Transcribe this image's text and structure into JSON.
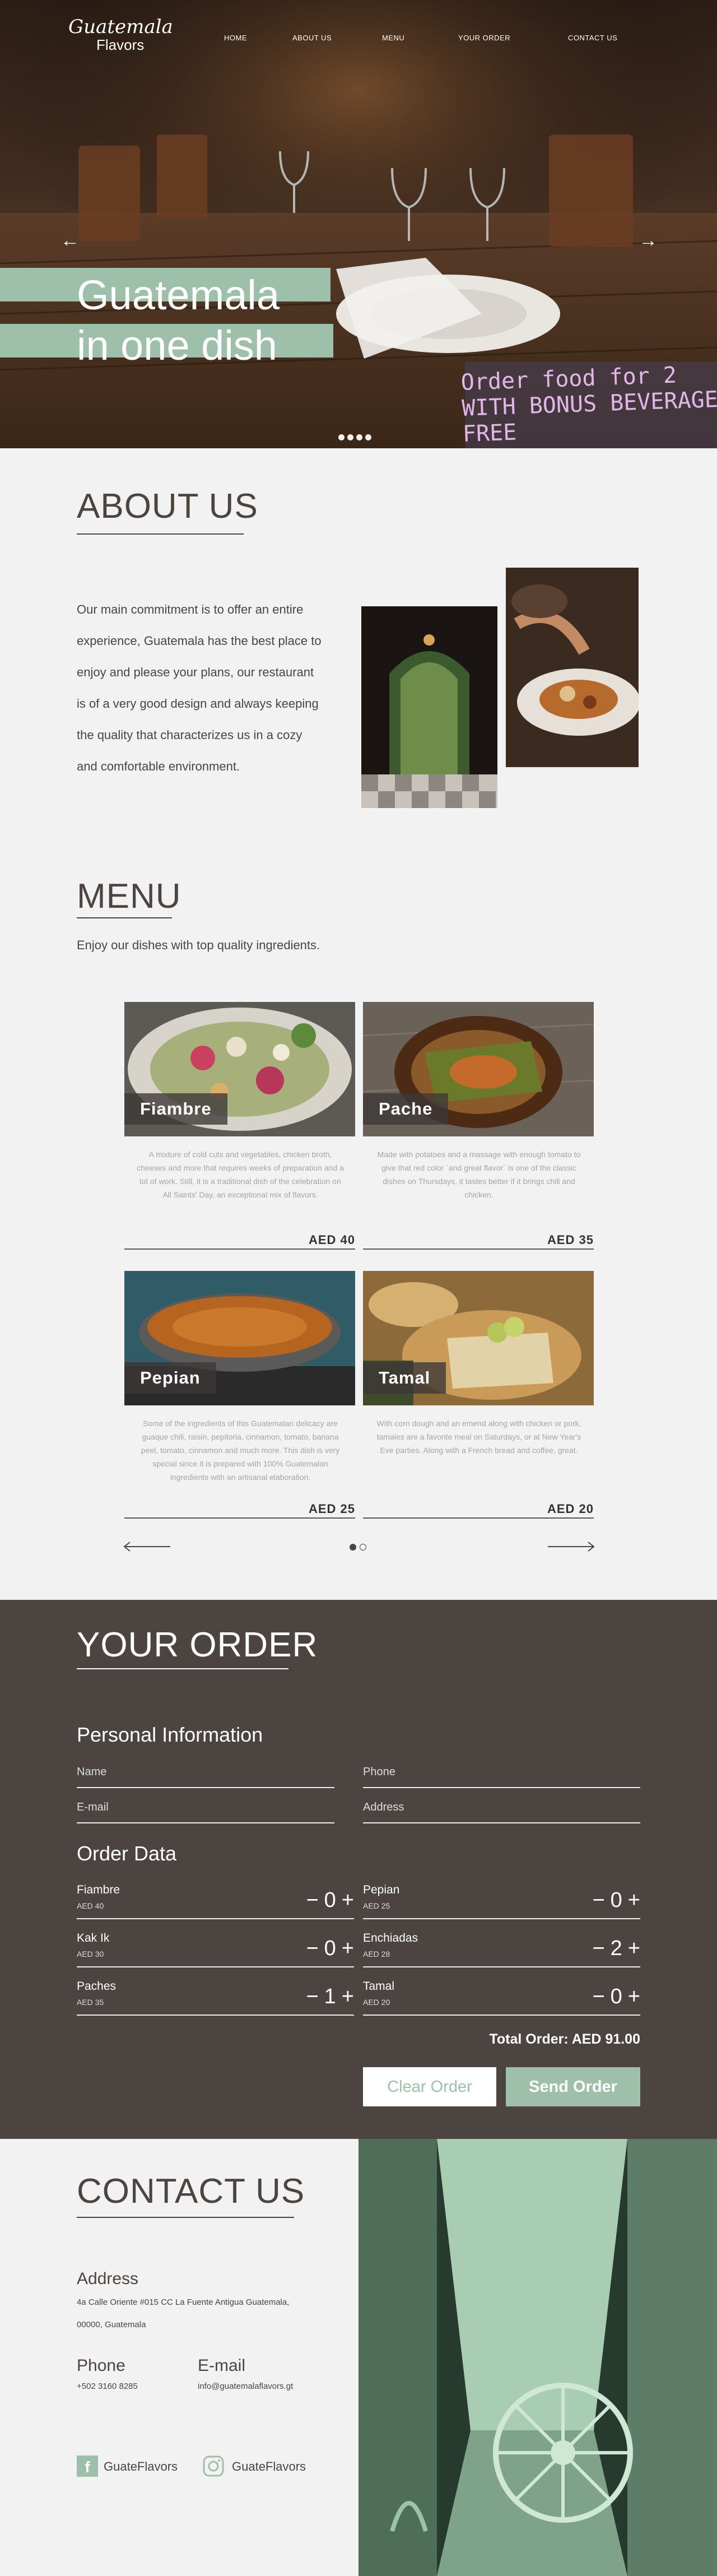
{
  "logo": {
    "line1": "Guatemala",
    "line2": "Flavors"
  },
  "nav": {
    "home": "HOME",
    "about": "ABOUT US",
    "menu": "MENU",
    "order": "YOUR ORDER",
    "contact": "CONTACT US"
  },
  "hero": {
    "title_line1": "Guatemala",
    "title_line2": "in one dish",
    "promo_line1": "Order food for 2",
    "promo_line2": "WITH BONUS BEVERAGE FREE",
    "slide_count": 4,
    "active_slide": 1
  },
  "about": {
    "title": "ABOUT US",
    "text": "Our main commitment is to offer an entire experience, Guatemala has the best place to enjoy and please your plans, our restaurant is of a very good design and always keeping the quality that characterizes us in a cozy and comfortable environment."
  },
  "menu": {
    "title": "MENU",
    "intro": "Enjoy our dishes with top quality ingredients.",
    "items": [
      {
        "name": "Fiambre",
        "desc": "A mixture of cold cuts and vegetables, chicken broth, cheeses and more that requires weeks of preparation and a lot of work. Still, it is a traditional dish of the celebration on All Saints' Day, an exceptional mix of flavors.",
        "price": "AED 40"
      },
      {
        "name": "Pache",
        "desc": "Made with potatoes and a massage with enough tomato to give that red color ´and great flavor´ is one of the classic dishes on Thursdays, it tastes better if it brings chili and chicken.",
        "price": "AED 35"
      },
      {
        "name": "Pepian",
        "desc": "Some of the ingredients of this Guatemalan delicacy are guaque chili, raisin, pepitoria, cinnamon, tomato, banana peel, tomato, cinnamon and much more. This dish is very special since it is prepared with 100% Guatemalan ingredients with an artisanal elaboration.",
        "price": "AED 25"
      },
      {
        "name": "Tamal",
        "desc": "With corn dough and an emend along with chicken or pork, tamales are a favorite meal on Saturdays, or at New Year's Eve parties. Along with a French bread and coffee, great.",
        "price": "AED 20"
      }
    ]
  },
  "order": {
    "title": "YOUR ORDER",
    "personal_title": "Personal Information",
    "name_ph": "Name",
    "phone_ph": "Phone",
    "email_ph": "E-mail",
    "address_ph": "Address",
    "data_title": "Order Data",
    "items": [
      {
        "name": "Fiambre",
        "price": "AED 40",
        "qty": "0"
      },
      {
        "name": "Pepian",
        "price": "AED 25",
        "qty": "0"
      },
      {
        "name": "Kak Ik",
        "price": "AED 30",
        "qty": "0"
      },
      {
        "name": "Enchiadas",
        "price": "AED 28",
        "qty": "2"
      },
      {
        "name": "Paches",
        "price": "AED 35",
        "qty": "1"
      },
      {
        "name": "Tamal",
        "price": "AED 20",
        "qty": "0"
      }
    ],
    "minus": "−",
    "plus": "+",
    "total": "Total Order: AED 91.00",
    "clear": "Clear Order",
    "send": "Send Order"
  },
  "contact": {
    "title": "CONTACT US",
    "address_label": "Address",
    "address_line1": "4a Calle Oriente #015 CC La Fuente Antigua Guatemala,",
    "address_line2": "00000, Guatemala",
    "phone_label": "Phone",
    "phone": "+502 3160 8285",
    "email_label": "E-mail",
    "email": "info@guatemalaflavors.gt",
    "facebook": "GuateFlavors",
    "instagram": "GuateFlavors"
  },
  "colors": {
    "accent": "#9ebfaa",
    "dark": "#4b4441",
    "light": "#f2f2f2",
    "promo": "#e3b6e8"
  }
}
